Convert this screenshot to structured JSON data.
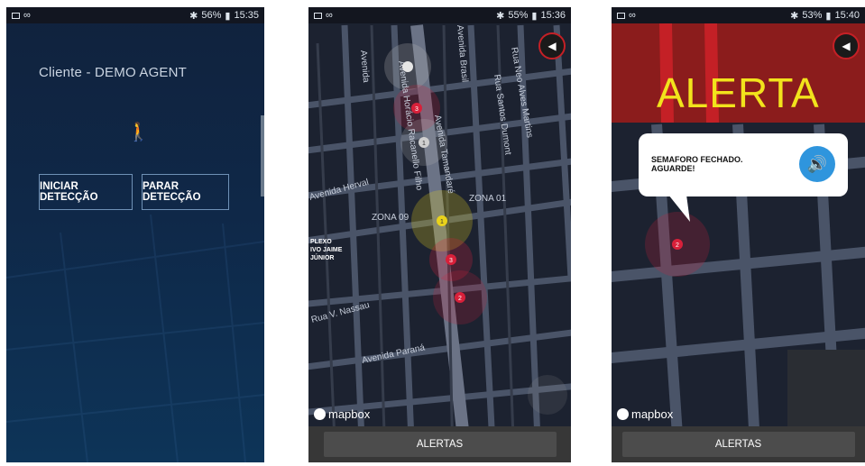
{
  "screen1": {
    "status": {
      "left_icons": [
        "gallery-icon",
        "voicemail-icon"
      ],
      "right": "56%",
      "time": "15:35"
    },
    "title": "Cliente - DEMO AGENT",
    "start_button": "INICIAR DETECÇÃO",
    "stop_button": "PARAR DETECÇÃO"
  },
  "screen2": {
    "status": {
      "right": "55%",
      "time": "15:36"
    },
    "streets": [
      "Avenida",
      "Avenida Brasil",
      "Rua Neo Alves Martins",
      "Rua Santos Dumont",
      "Avenida Tamandaré",
      "Avenida Horácio Racanello Filho",
      "Avenida Herval",
      "Rua V. Nassau",
      "Avenida Paraná"
    ],
    "zones": [
      "ZONA 09",
      "ZONA 01"
    ],
    "poi": [
      "PLEXO",
      "IVO JAIME",
      "JÚNIOR"
    ],
    "markers": [
      "3",
      "1",
      "1",
      "3",
      "2"
    ],
    "brand": "mapbox",
    "alert_button": "ALERTAS"
  },
  "screen3": {
    "status": {
      "right": "53%",
      "time": "15:40"
    },
    "alert_title": "ALERTA",
    "message_line1": "SEMAFORO FECHADO.",
    "message_line2": "AGUARDE!",
    "marker": "2",
    "brand": "mapbox",
    "alert_button": "ALERTAS"
  },
  "colors": {
    "accent_blue": "#2f95dd",
    "alert_yellow": "#f2e31c",
    "marker_red": "#d8203a",
    "marker_yellow": "#e9d21b"
  }
}
